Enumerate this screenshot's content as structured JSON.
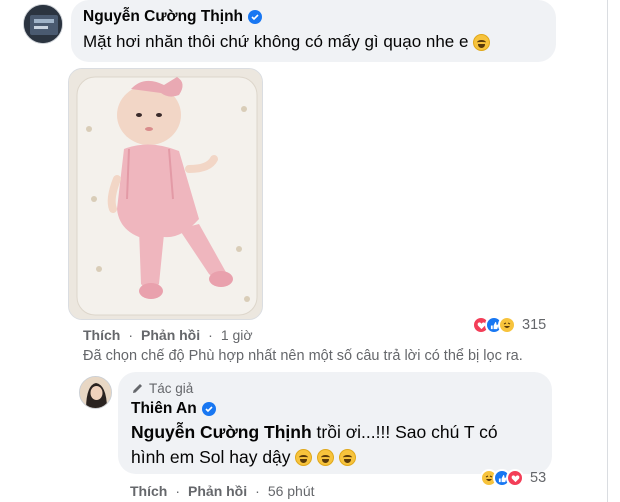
{
  "comment1": {
    "author": "Nguyễn Cường Thịnh",
    "text": "Mặt hơi nhăn thôi chứ không có mấy gì quạo nhe e",
    "photo_icon": "baby-photo",
    "actions": {
      "like": "Thích",
      "reply": "Phản hồi",
      "time": "1 giờ"
    },
    "reaction_count": "315",
    "reaction_icons": [
      "love-icon",
      "like-icon",
      "haha-icon"
    ]
  },
  "filter_note": "Đã chọn chế độ Phù hợp nhất nên một số câu trả lời có thể bị lọc ra.",
  "reply": {
    "author_tag": "Tác giả",
    "author": "Thiên An",
    "mention": "Nguyễn Cường Thịnh",
    "text": " trồi ơi...!!! Sao chú T có hình em Sol hay dậy",
    "actions": {
      "like": "Thích",
      "reply": "Phản hồi",
      "time": "56 phút"
    },
    "reaction_count": "53",
    "reaction_icons": [
      "haha-icon",
      "like-icon",
      "love-icon"
    ]
  },
  "colors": {
    "bubble": "#f0f2f5",
    "verified": "#1877f2",
    "secondary_text": "#65676b",
    "love": "#f33e58",
    "like": "#1877f2",
    "haha": "#f7c33c"
  }
}
